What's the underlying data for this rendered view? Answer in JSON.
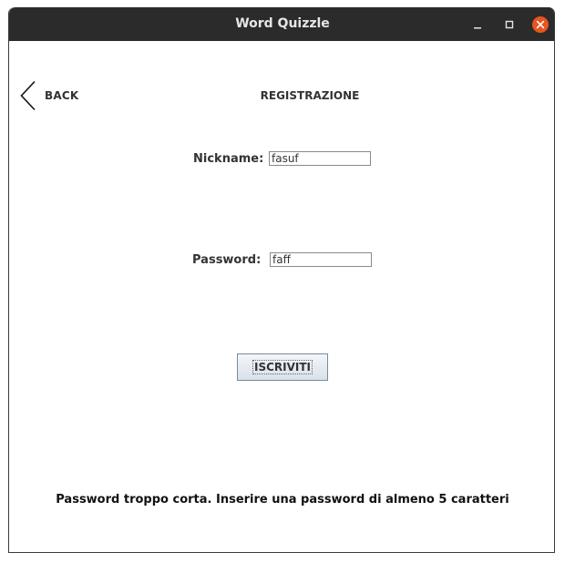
{
  "window": {
    "title": "Word Quizzle",
    "controls": [
      "minimize-icon",
      "maximize-icon",
      "close-icon"
    ],
    "close_color": "#e95420"
  },
  "nav": {
    "back_label": "BACK",
    "back_icon": "chevron-left-icon"
  },
  "page": {
    "heading": "REGISTRAZIONE"
  },
  "form": {
    "nickname_label": "Nickname:",
    "nickname_value": "fasuf",
    "password_label": "Password:",
    "password_value": "faff",
    "submit_label": "ISCRIVITI"
  },
  "status": {
    "message": "Password troppo corta. Inserire una password di almeno 5 caratteri"
  }
}
